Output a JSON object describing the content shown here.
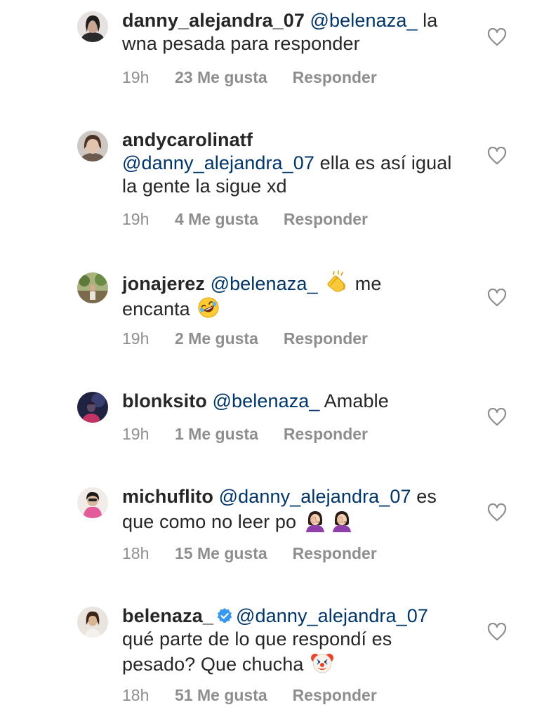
{
  "comments": [
    {
      "username": "danny_alejandra_07",
      "mention": "@belenaza_",
      "text_1": " la wna pesada para responder",
      "time": "19h",
      "likes": "23 Me gusta",
      "reply": "Responder"
    },
    {
      "username": "andycarolinatf",
      "mention": "@danny_alejandra_07",
      "text_1": " ella es así igual la gente la sigue xd",
      "time": "19h",
      "likes": "4 Me gusta",
      "reply": "Responder"
    },
    {
      "username": "jonajerez",
      "mention": "@belenaza_",
      "text_1": " me encanta",
      "time": "19h",
      "likes": "2 Me gusta",
      "reply": "Responder"
    },
    {
      "username": "blonksito",
      "mention": "@belenaza_",
      "text_1": " Amable",
      "time": "19h",
      "likes": "1 Me gusta",
      "reply": "Responder"
    },
    {
      "username": "michuflito",
      "mention": "@danny_alejandra_07",
      "text_1": " es que como no leer po",
      "time": "18h",
      "likes": "15 Me gusta",
      "reply": "Responder"
    },
    {
      "username": "belenaza_",
      "mention": "@danny_alejandra_07",
      "text_1": " qué parte de lo que respondí es pesado? Que chucha",
      "time": "18h",
      "likes": "51 Me gusta",
      "reply": "Responder"
    }
  ],
  "icons": {
    "heart": "heart-outline-icon",
    "verified": "verified-badge-icon",
    "emoji_clap": "clapping-hands-emoji",
    "emoji_rofl": "rolling-on-floor-laughing-emoji",
    "emoji_facepalm": "woman-facepalming-emoji",
    "emoji_clown": "clown-face-emoji"
  },
  "colors": {
    "text": "#262626",
    "mention": "#003569",
    "meta": "#8e8e8e",
    "verified": "#3897f0"
  }
}
